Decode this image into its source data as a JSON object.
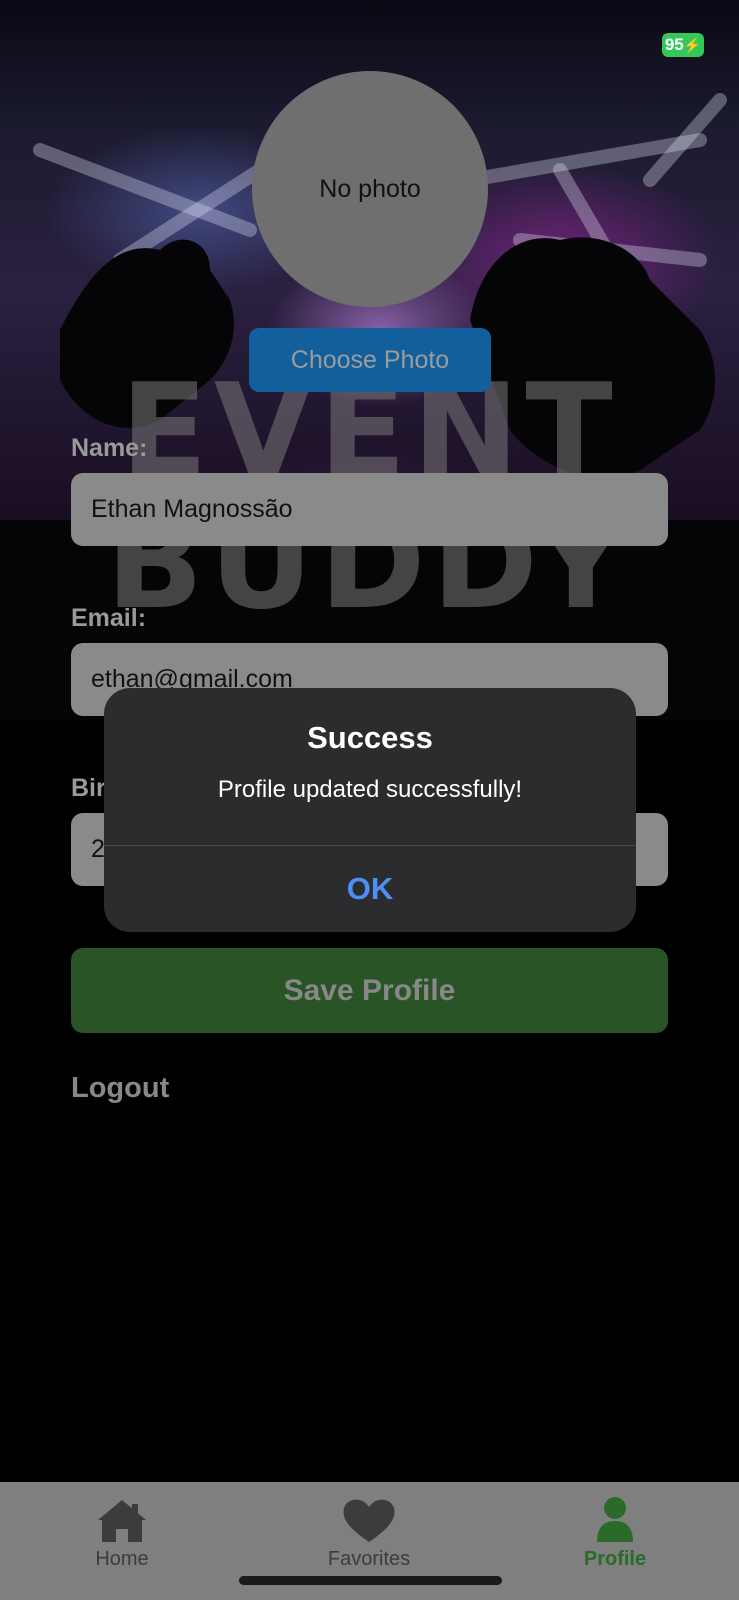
{
  "status_bar": {
    "battery": "95"
  },
  "watermark": {
    "line1": "EVENT",
    "line2": "BUDDY"
  },
  "profile": {
    "avatar_placeholder": "No photo",
    "choose_photo_label": "Choose Photo"
  },
  "form": {
    "name_label": "Name:",
    "name_value": "Ethan Magnossão",
    "email_label": "Email:",
    "email_value": "ethan@gmail.com",
    "birth_label_visible": "Bir",
    "birth_value_visible": "2",
    "save_label": "Save Profile",
    "logout_label": "Logout"
  },
  "alert": {
    "title": "Success",
    "message": "Profile updated successfully!",
    "ok_label": "OK"
  },
  "tabbar": {
    "items": [
      {
        "label": "Home",
        "icon": "house-icon",
        "active": false
      },
      {
        "label": "Favorites",
        "icon": "heart-icon",
        "active": false
      },
      {
        "label": "Profile",
        "icon": "person-icon",
        "active": true
      }
    ]
  },
  "colors": {
    "accent_blue": "#125f9c",
    "save_green": "#295426",
    "active_tab": "#2a6b2a",
    "alert_link": "#4d8ef7",
    "battery_green": "#34c759"
  }
}
